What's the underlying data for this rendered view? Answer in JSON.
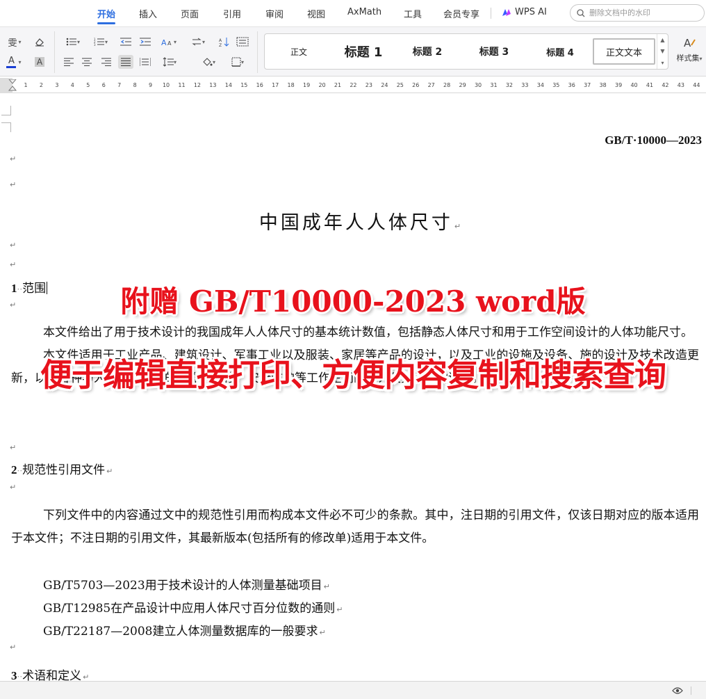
{
  "menu": {
    "tabs": [
      {
        "label": "开始",
        "active": true
      },
      {
        "label": "插入"
      },
      {
        "label": "页面"
      },
      {
        "label": "引用"
      },
      {
        "label": "审阅"
      },
      {
        "label": "视图"
      },
      {
        "label": "AxMath"
      },
      {
        "label": "工具"
      },
      {
        "label": "会员专享"
      }
    ],
    "wps_ai_label": "WPS AI",
    "search_placeholder": "删除文档中的水印",
    "accent_color": "#2d6ee0"
  },
  "toolbar": {
    "pinyin_glyph": "雯",
    "font_color_glyph": "A",
    "highlight_glyph": "A",
    "styles": [
      {
        "label": "正文"
      },
      {
        "label": "标题 1"
      },
      {
        "label": "标题 2"
      },
      {
        "label": "标题 3"
      },
      {
        "label": "标题 4"
      },
      {
        "label": "正文文本",
        "selected": true
      }
    ],
    "styles_set_label": "样式集"
  },
  "ruler": {
    "ticks": [
      "1",
      "2",
      "3",
      "4",
      "5",
      "6",
      "7",
      "8",
      "9",
      "10",
      "11",
      "12",
      "13",
      "14",
      "15",
      "16",
      "17",
      "18",
      "19",
      "20",
      "21",
      "22",
      "23",
      "24",
      "25",
      "26",
      "27",
      "28",
      "29",
      "30",
      "31",
      "32",
      "33",
      "34",
      "35",
      "36",
      "37",
      "38",
      "39",
      "40",
      "41",
      "42",
      "43",
      "44"
    ]
  },
  "document": {
    "header_code": "GB/T·10000—2023",
    "title": "中国成年人人体尺寸",
    "para_mark": "↵",
    "section1": {
      "num": "1",
      "dots": "··",
      "text": "范围"
    },
    "section1_text_p1": "本文件给出了用于技术设计的我国成年人人体尺寸的基本统计数值，包括静态人体尺寸和用于工作空间设计的人体功能尺寸。",
    "section1_text_p2": "本文件适用于工业产品、建筑设计、军事工业以及服装、家居等产品的设计，以及工业的设施及设备、施的设计及技术改造更新，以及各种与人体尺寸相关的操作、维修、安全防护等工作空间的设计及其工效学评价。",
    "section2": {
      "num": "2",
      "dots": "··",
      "text": "规范性引用文件"
    },
    "section2_text": "下列文件中的内容通过文中的规范性引用而构成本文件必不可少的条款。其中，注日期的引用文件，仅该日期对应的版本适用于本文件；不注日期的引用文件，其最新版本(包括所有的修改单)适用于本文件。",
    "references": [
      "GB/T5703—2023用于技术设计的人体测量基础项目",
      "GB/T12985在产品设计中应用人体尺寸百分位数的通则",
      "GB/T22187—2008建立人体测量数据库的一般要求"
    ],
    "section3": {
      "num": "3",
      "dots": "··",
      "text": "术语和定义"
    }
  },
  "promo": {
    "line1": "附赠 GB/T10000-2023 word版",
    "line2": "便于编辑直接打印、方便内容复制和搜索查询",
    "color": "#e8121c"
  }
}
